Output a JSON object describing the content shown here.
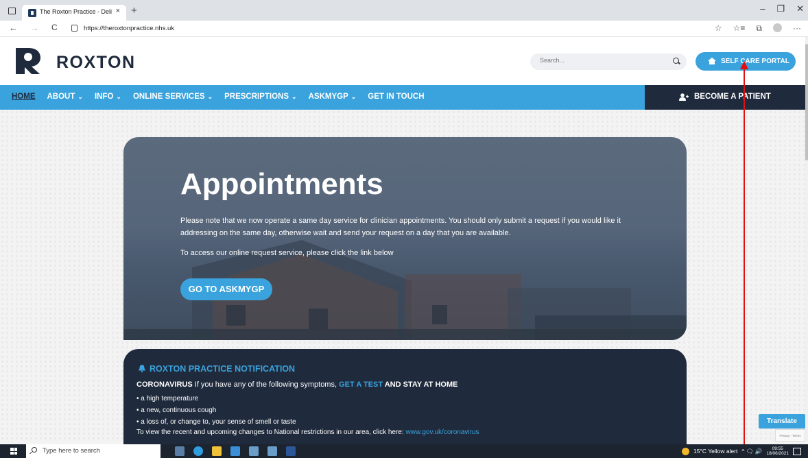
{
  "browser": {
    "tab_title": "The Roxton Practice - Delivering",
    "tab_close": "×",
    "new_tab": "+",
    "url": "https://theroxtonpractice.nhs.uk",
    "window_controls": {
      "minimize": "–",
      "restore": "❐",
      "close": "✕"
    },
    "nav": {
      "back": "←",
      "forward": "→",
      "refresh": "C"
    },
    "addr_icons": {
      "favorite": "☆",
      "favorites": "☆≡",
      "collections": "⧉",
      "more": "···"
    }
  },
  "header": {
    "logo_text": "ROXTON",
    "search_placeholder": "Search...",
    "self_care_label": "SELF CARE PORTAL"
  },
  "nav": {
    "items": [
      {
        "label": "HOME",
        "dropdown": ""
      },
      {
        "label": "ABOUT",
        "dropdown": "⌄"
      },
      {
        "label": "INFO",
        "dropdown": "⌄"
      },
      {
        "label": "ONLINE SERVICES",
        "dropdown": "⌄"
      },
      {
        "label": "PRESCRIPTIONS",
        "dropdown": "⌄"
      },
      {
        "label": "ASKMYGP",
        "dropdown": "⌄"
      },
      {
        "label": "GET IN TOUCH",
        "dropdown": ""
      }
    ],
    "become_patient": "BECOME A PATIENT"
  },
  "hero": {
    "title": "Appointments",
    "paragraph1": "Please note that we now operate a same day service for clinician appointments. You should only submit a request if you would like it addressing on the same day, otherwise wait and send your request on a day that you are available.",
    "paragraph2": "To access our online request service, please click the link below",
    "button": "GO TO ASKMYGP"
  },
  "notification": {
    "title": "ROXTON PRACTICE NOTIFICATION",
    "line1_bold": "CORONAVIRUS",
    "line1_text": " If you have any of the following symptoms, ",
    "line1_link": "GET A TEST",
    "line1_end": " AND STAY AT HOME",
    "bullets": [
      "• a high temperature",
      "• a new, continuous cough",
      "• a loss of, or change to, your sense of smell or taste"
    ],
    "line5_text": "To view the recent and upcoming changes to National restrictions in our area, click here: ",
    "line5_link": "www.gov.uk/coronavirus"
  },
  "widgets": {
    "translate": "Translate",
    "recaptcha": "Privacy - Terms"
  },
  "taskbar": {
    "search_text": "Type here to search",
    "weather": "15°C  Yellow alert",
    "tray_icons": "^ 🗨 🔊",
    "time": "09:55",
    "date": "18/06/2021"
  },
  "colors": {
    "brand_blue": "#3aa3dd",
    "brand_navy": "#1f2a3c"
  }
}
